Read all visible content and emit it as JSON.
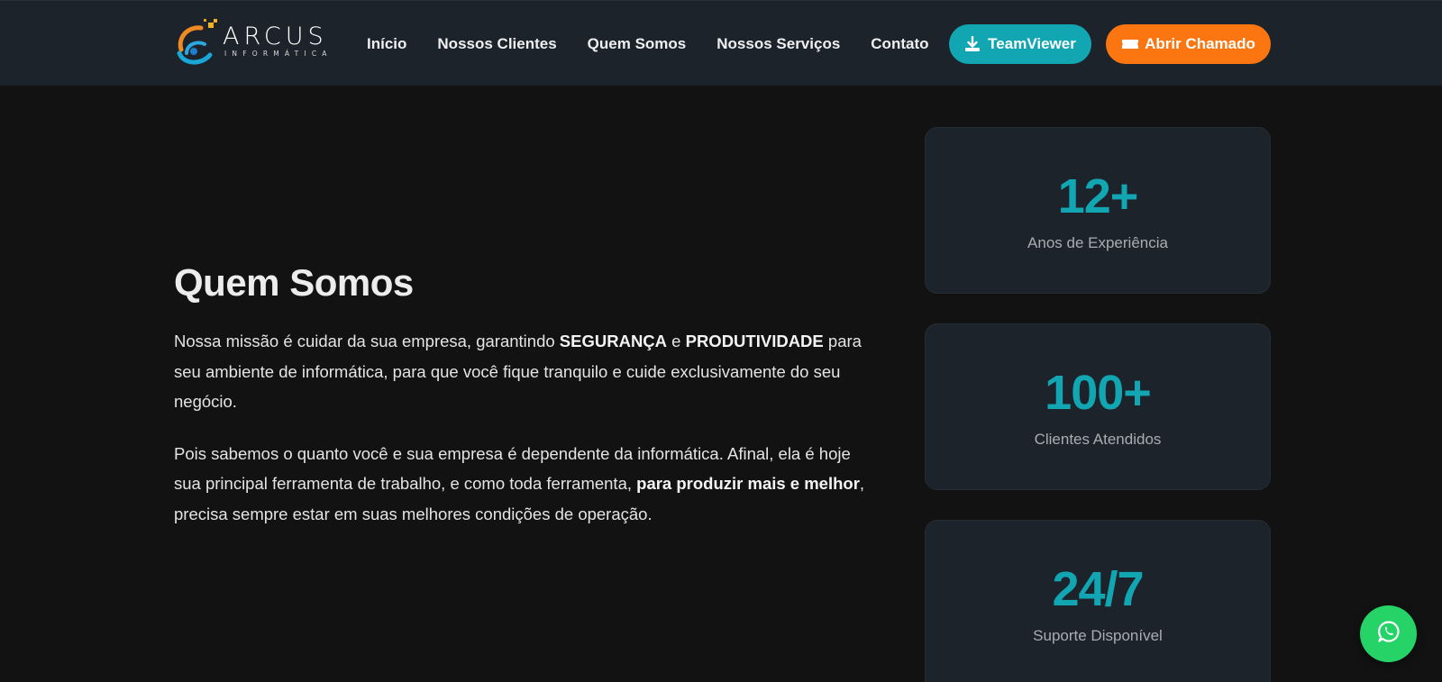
{
  "header": {
    "logo": {
      "name": "ARCUS",
      "subtitle": "INFORMÁTICA",
      "icon": "arcus-logo-icon"
    },
    "nav": [
      {
        "label": "Início"
      },
      {
        "label": "Nossos Clientes"
      },
      {
        "label": "Quem Somos"
      },
      {
        "label": "Nossos Serviços"
      },
      {
        "label": "Contato"
      }
    ],
    "teamviewer_label": "TeamViewer",
    "teamviewer_icon": "download-icon",
    "chamado_label": "Abrir Chamado",
    "chamado_icon": "ticket-icon"
  },
  "about": {
    "title": "Quem Somos",
    "p1": {
      "t1": "Nossa missão é cuidar da sua empresa, garantindo ",
      "b1": "SEGURANÇA",
      "t2": " e ",
      "b2": "PRODUTIVIDADE",
      "t3": " para seu ambiente de informática, para que você fique tranquilo e cuide exclusivamente do seu negócio."
    },
    "p2": {
      "t1": "Pois sabemos o quanto você e sua empresa é dependente da informática. Afinal, ela é hoje sua principal ferramenta de trabalho, e como toda ferramenta, ",
      "b1": "para produzir mais e melhor",
      "t2": ", precisa sempre estar em suas melhores condições de operação."
    }
  },
  "stats": [
    {
      "value": "12+",
      "label": "Anos de Experiência"
    },
    {
      "value": "100+",
      "label": "Clientes Atendidos"
    },
    {
      "value": "24/7",
      "label": "Suporte Disponível"
    }
  ],
  "colors": {
    "accent": "#12a6b3",
    "orange": "#fb7511",
    "whatsapp": "#25d366",
    "background": "#121212",
    "header": "#1d232a"
  },
  "floating": {
    "icon": "whatsapp-icon"
  }
}
